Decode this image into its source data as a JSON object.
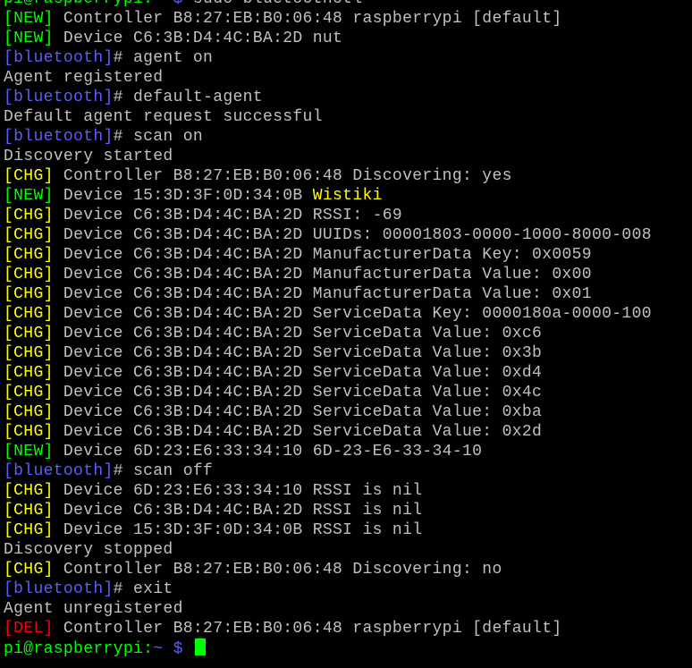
{
  "colors": {
    "background": "#000000",
    "default": "#c0c0c0",
    "prompt_user": "#00ff00",
    "prompt_path": "#5c5cff",
    "bracket_tag": "#5c5cff",
    "new": "#00ff00",
    "chg": "#ffff00",
    "del": "#ff0000",
    "name_highlight": "#ffff00",
    "cursor": "#00ff00"
  },
  "lines": [
    [
      {
        "t": "pi@raspberrypi:",
        "c": "prompt_user"
      },
      {
        "t": "~ $",
        "c": "prompt_path"
      },
      {
        "t": " sudo bluetoothctl",
        "c": "default"
      }
    ],
    [
      {
        "t": "[NEW]",
        "c": "new"
      },
      {
        "t": " Controller B8:27:EB:B0:06:48 raspberrypi [default]",
        "c": "default"
      }
    ],
    [
      {
        "t": "[NEW]",
        "c": "new"
      },
      {
        "t": " Device C6:3B:D4:4C:BA:2D nut",
        "c": "default"
      }
    ],
    [
      {
        "t": "[bluetooth]",
        "c": "bracket_tag"
      },
      {
        "t": "# agent on",
        "c": "default"
      }
    ],
    [
      {
        "t": "Agent registered",
        "c": "default"
      }
    ],
    [
      {
        "t": "[bluetooth]",
        "c": "bracket_tag"
      },
      {
        "t": "# default-agent",
        "c": "default"
      }
    ],
    [
      {
        "t": "Default agent request successful",
        "c": "default"
      }
    ],
    [
      {
        "t": "[bluetooth]",
        "c": "bracket_tag"
      },
      {
        "t": "# scan on",
        "c": "default"
      }
    ],
    [
      {
        "t": "Discovery started",
        "c": "default"
      }
    ],
    [
      {
        "t": "[CHG]",
        "c": "chg"
      },
      {
        "t": " Controller B8:27:EB:B0:06:48 Discovering: yes",
        "c": "default"
      }
    ],
    [
      {
        "t": "[NEW]",
        "c": "new"
      },
      {
        "t": " Device 15:3D:3F:0D:34:0B ",
        "c": "default"
      },
      {
        "t": "Wistiki",
        "c": "name_highlight"
      }
    ],
    [
      {
        "t": "[CHG]",
        "c": "chg"
      },
      {
        "t": " Device C6:3B:D4:4C:BA:2D RSSI: -69",
        "c": "default"
      }
    ],
    [
      {
        "t": "[CHG]",
        "c": "chg"
      },
      {
        "t": " Device C6:3B:D4:4C:BA:2D UUIDs: 00001803-0000-1000-8000-008",
        "c": "default"
      }
    ],
    [
      {
        "t": "[CHG]",
        "c": "chg"
      },
      {
        "t": " Device C6:3B:D4:4C:BA:2D ManufacturerData Key: 0x0059",
        "c": "default"
      }
    ],
    [
      {
        "t": "[CHG]",
        "c": "chg"
      },
      {
        "t": " Device C6:3B:D4:4C:BA:2D ManufacturerData Value: 0x00",
        "c": "default"
      }
    ],
    [
      {
        "t": "[CHG]",
        "c": "chg"
      },
      {
        "t": " Device C6:3B:D4:4C:BA:2D ManufacturerData Value: 0x01",
        "c": "default"
      }
    ],
    [
      {
        "t": "[CHG]",
        "c": "chg"
      },
      {
        "t": " Device C6:3B:D4:4C:BA:2D ServiceData Key: 0000180a-0000-100",
        "c": "default"
      }
    ],
    [
      {
        "t": "[CHG]",
        "c": "chg"
      },
      {
        "t": " Device C6:3B:D4:4C:BA:2D ServiceData Value: 0xc6",
        "c": "default"
      }
    ],
    [
      {
        "t": "[CHG]",
        "c": "chg"
      },
      {
        "t": " Device C6:3B:D4:4C:BA:2D ServiceData Value: 0x3b",
        "c": "default"
      }
    ],
    [
      {
        "t": "[CHG]",
        "c": "chg"
      },
      {
        "t": " Device C6:3B:D4:4C:BA:2D ServiceData Value: 0xd4",
        "c": "default"
      }
    ],
    [
      {
        "t": "[CHG]",
        "c": "chg"
      },
      {
        "t": " Device C6:3B:D4:4C:BA:2D ServiceData Value: 0x4c",
        "c": "default"
      }
    ],
    [
      {
        "t": "[CHG]",
        "c": "chg"
      },
      {
        "t": " Device C6:3B:D4:4C:BA:2D ServiceData Value: 0xba",
        "c": "default"
      }
    ],
    [
      {
        "t": "[CHG]",
        "c": "chg"
      },
      {
        "t": " Device C6:3B:D4:4C:BA:2D ServiceData Value: 0x2d",
        "c": "default"
      }
    ],
    [
      {
        "t": "[NEW]",
        "c": "new"
      },
      {
        "t": " Device 6D:23:E6:33:34:10 6D-23-E6-33-34-10",
        "c": "default"
      }
    ],
    [
      {
        "t": "[bluetooth]",
        "c": "bracket_tag"
      },
      {
        "t": "# scan off",
        "c": "default"
      }
    ],
    [
      {
        "t": "[CHG]",
        "c": "chg"
      },
      {
        "t": " Device 6D:23:E6:33:34:10 RSSI is nil",
        "c": "default"
      }
    ],
    [
      {
        "t": "[CHG]",
        "c": "chg"
      },
      {
        "t": " Device C6:3B:D4:4C:BA:2D RSSI is nil",
        "c": "default"
      }
    ],
    [
      {
        "t": "[CHG]",
        "c": "chg"
      },
      {
        "t": " Device 15:3D:3F:0D:34:0B RSSI is nil",
        "c": "default"
      }
    ],
    [
      {
        "t": "Discovery stopped",
        "c": "default"
      }
    ],
    [
      {
        "t": "[CHG]",
        "c": "chg"
      },
      {
        "t": " Controller B8:27:EB:B0:06:48 Discovering: no",
        "c": "default"
      }
    ],
    [
      {
        "t": "[bluetooth]",
        "c": "bracket_tag"
      },
      {
        "t": "# exit",
        "c": "default"
      }
    ],
    [
      {
        "t": "Agent unregistered",
        "c": "default"
      }
    ],
    [
      {
        "t": "[DEL]",
        "c": "del"
      },
      {
        "t": " Controller B8:27:EB:B0:06:48 raspberrypi [default]",
        "c": "default"
      }
    ],
    [
      {
        "t": "pi@raspberrypi:",
        "c": "prompt_user"
      },
      {
        "t": "~ $",
        "c": "prompt_path"
      },
      {
        "t": " ",
        "c": "default"
      }
    ]
  ],
  "cursor_icon": "block-cursor"
}
